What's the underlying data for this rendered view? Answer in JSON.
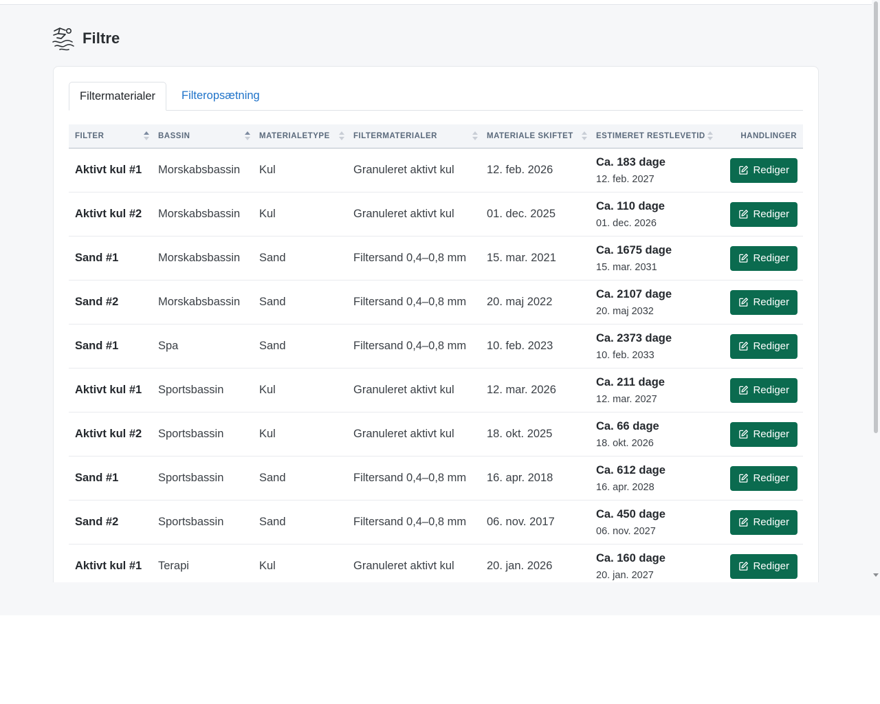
{
  "page": {
    "title": "Filtre",
    "icon": "swimmer-icon"
  },
  "tabs": [
    {
      "label": "Filtermaterialer",
      "active": true
    },
    {
      "label": "Filteropsætning",
      "active": false
    }
  ],
  "table": {
    "headers": [
      "FILTER",
      "BASSIN",
      "MATERIALETYPE",
      "FILTERMATERIALER",
      "MATERIALE SKIFTET",
      "ESTIMERET RESTLEVETID",
      "HANDLINGER"
    ],
    "edit_label": "Rediger",
    "rows": [
      {
        "filter": "Aktivt kul #1",
        "bassin": "Morskabsbassin",
        "type": "Kul",
        "material": "Granuleret aktivt kul",
        "changed": "12. feb. 2026",
        "rest": "Ca. 183 dage",
        "rest_date": "12. feb. 2027"
      },
      {
        "filter": "Aktivt kul #2",
        "bassin": "Morskabsbassin",
        "type": "Kul",
        "material": "Granuleret aktivt kul",
        "changed": "01. dec. 2025",
        "rest": "Ca. 110 dage",
        "rest_date": "01. dec. 2026"
      },
      {
        "filter": "Sand #1",
        "bassin": "Morskabsbassin",
        "type": "Sand",
        "material": "Filtersand 0,4–0,8 mm",
        "changed": "15. mar. 2021",
        "rest": "Ca. 1675 dage",
        "rest_date": "15. mar. 2031"
      },
      {
        "filter": "Sand #2",
        "bassin": "Morskabsbassin",
        "type": "Sand",
        "material": "Filtersand 0,4–0,8 mm",
        "changed": "20. maj 2022",
        "rest": "Ca. 2107 dage",
        "rest_date": "20. maj 2032"
      },
      {
        "filter": "Sand #1",
        "bassin": "Spa",
        "type": "Sand",
        "material": "Filtersand 0,4–0,8 mm",
        "changed": "10. feb. 2023",
        "rest": "Ca. 2373 dage",
        "rest_date": "10. feb. 2033"
      },
      {
        "filter": "Aktivt kul #1",
        "bassin": "Sportsbassin",
        "type": "Kul",
        "material": "Granuleret aktivt kul",
        "changed": "12. mar. 2026",
        "rest": "Ca. 211 dage",
        "rest_date": "12. mar. 2027"
      },
      {
        "filter": "Aktivt kul #2",
        "bassin": "Sportsbassin",
        "type": "Kul",
        "material": "Granuleret aktivt kul",
        "changed": "18. okt. 2025",
        "rest": "Ca. 66 dage",
        "rest_date": "18. okt. 2026"
      },
      {
        "filter": "Sand #1",
        "bassin": "Sportsbassin",
        "type": "Sand",
        "material": "Filtersand 0,4–0,8 mm",
        "changed": "16. apr. 2018",
        "rest": "Ca. 612 dage",
        "rest_date": "16. apr. 2028"
      },
      {
        "filter": "Sand #2",
        "bassin": "Sportsbassin",
        "type": "Sand",
        "material": "Filtersand 0,4–0,8 mm",
        "changed": "06. nov. 2017",
        "rest": "Ca. 450 dage",
        "rest_date": "06. nov. 2027"
      },
      {
        "filter": "Aktivt kul #1",
        "bassin": "Terapi",
        "type": "Kul",
        "material": "Granuleret aktivt kul",
        "changed": "20. jan. 2026",
        "rest": "Ca. 160 dage",
        "rest_date": "20. jan. 2027"
      }
    ]
  },
  "colors": {
    "accent_button": "#0b6b4f",
    "link": "#1f73c9",
    "page_bg": "#f6f7f9"
  }
}
